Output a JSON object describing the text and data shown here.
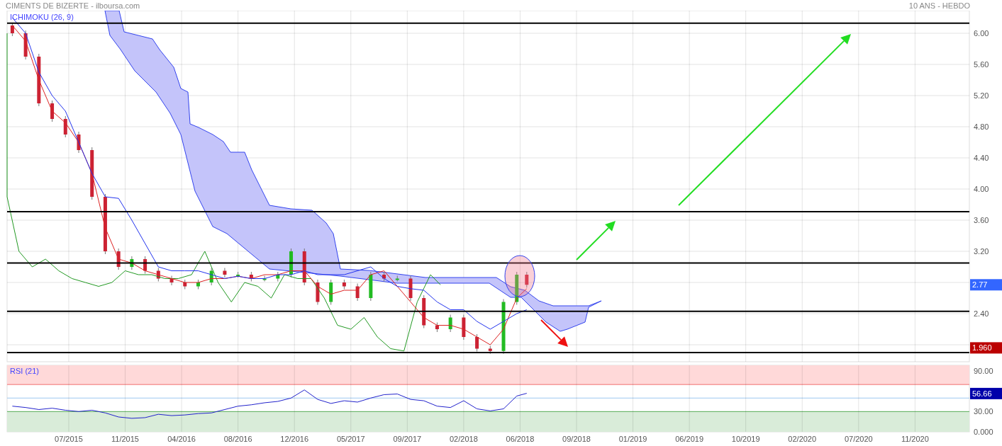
{
  "header": {
    "title": "CIMENTS DE BIZERTE - ilboursa.com",
    "period": "10 ANS - HEBDO"
  },
  "price_panel": {
    "legend": "ICHIMOKU (26, 9)",
    "axis_labels": [
      "6.00",
      "5.60",
      "5.20",
      "4.80",
      "4.40",
      "4.00",
      "3.60",
      "3.20",
      "2.40"
    ],
    "badges": [
      {
        "label": "2.77",
        "color": "#3366ff"
      },
      {
        "label": "1.960",
        "color": "#bb0000"
      }
    ]
  },
  "rsi_panel": {
    "legend": "RSI (21)",
    "axis_labels": [
      "90.00",
      "30.00",
      "0.000"
    ],
    "badges": [
      {
        "label": "56.66",
        "color": "#0000aa"
      }
    ]
  },
  "time_axis": [
    "07/2015",
    "11/2015",
    "04/2016",
    "08/2016",
    "12/2016",
    "05/2017",
    "09/2017",
    "02/2018",
    "06/2018",
    "09/2018",
    "01/2019",
    "06/2019",
    "10/2019",
    "02/2020",
    "07/2020",
    "11/2020"
  ]
}
